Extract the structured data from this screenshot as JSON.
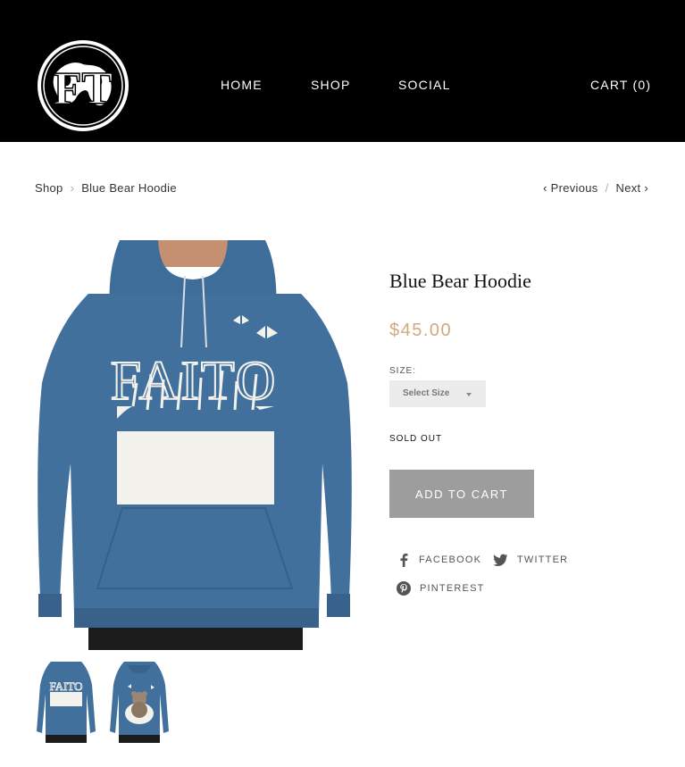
{
  "header": {
    "logo_letters": "FT",
    "nav": [
      "HOME",
      "SHOP",
      "SOCIAL"
    ],
    "cart_label": "CART (0)"
  },
  "breadcrumb": {
    "shop": "Shop",
    "separator": "›",
    "current": "Blue Bear Hoodie"
  },
  "pager": {
    "previous": "‹ Previous",
    "separator": "/",
    "next": "Next ›"
  },
  "product": {
    "title": "Blue Bear Hoodie",
    "price": "$45.00",
    "size_label": "SIZE:",
    "size_value": "Select Size",
    "stock_status": "SOLD OUT",
    "add_to_cart": "ADD TO CART",
    "image_print_text": "FAITO",
    "thumb_print_text": "FAITO"
  },
  "share": {
    "facebook": "FACEBOOK",
    "twitter": "TWITTER",
    "pinterest": "PINTEREST"
  },
  "colors": {
    "header_bg": "#000000",
    "price": "#d3a97b",
    "accent_sep": "#c9a98a",
    "button_bg": "#9d9d9d",
    "hoodie": "#41709d"
  }
}
